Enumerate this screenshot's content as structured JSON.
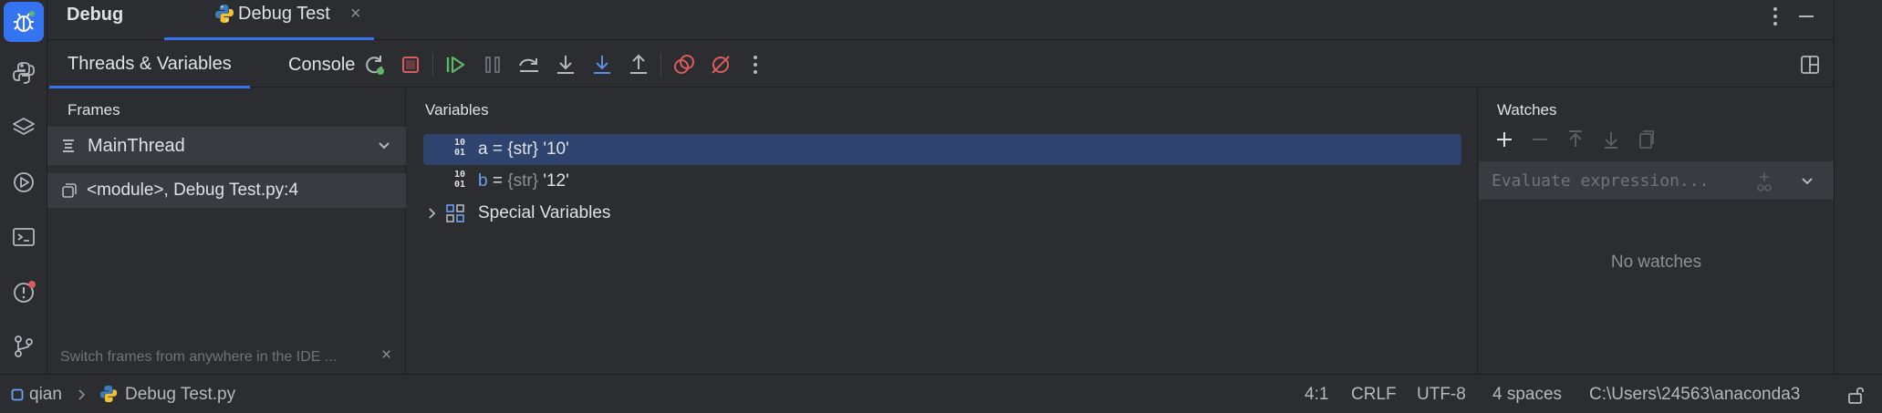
{
  "debug_panel": {
    "title": "Debug",
    "session_tab": {
      "label": "Debug Test",
      "close": "×"
    }
  },
  "toolbar": {
    "tabs": [
      {
        "label": "Threads & Variables"
      },
      {
        "label": "Console"
      }
    ]
  },
  "frames": {
    "header": "Frames",
    "thread": "MainThread",
    "items": [
      {
        "label": "<module>, Debug Test.py:4"
      }
    ],
    "hint": "Switch frames from anywhere in the IDE ...",
    "hint_close": "×"
  },
  "variables": {
    "header": "Variables",
    "rows": [
      {
        "name": "a",
        "eq": " = ",
        "type": "{str}",
        "value": " '10'"
      },
      {
        "name": "b",
        "eq": " = ",
        "type": "{str}",
        "value": " '12'"
      }
    ],
    "special": "Special Variables"
  },
  "watches": {
    "header": "Watches",
    "placeholder": "Evaluate expression...",
    "empty": "No watches"
  },
  "statusbar": {
    "project": "qian",
    "file": "Debug Test.py",
    "position": "4:1",
    "line_ending": "CRLF",
    "encoding": "UTF-8",
    "indent": "4 spaces",
    "interpreter": "C:\\Users\\24563\\anaconda3"
  },
  "colors": {
    "accent": "#3574f0",
    "selection": "#2e436e",
    "stop_red": "#db5c5c",
    "resume_green": "#5fb865",
    "breakpoint_red": "#db5c5c"
  }
}
